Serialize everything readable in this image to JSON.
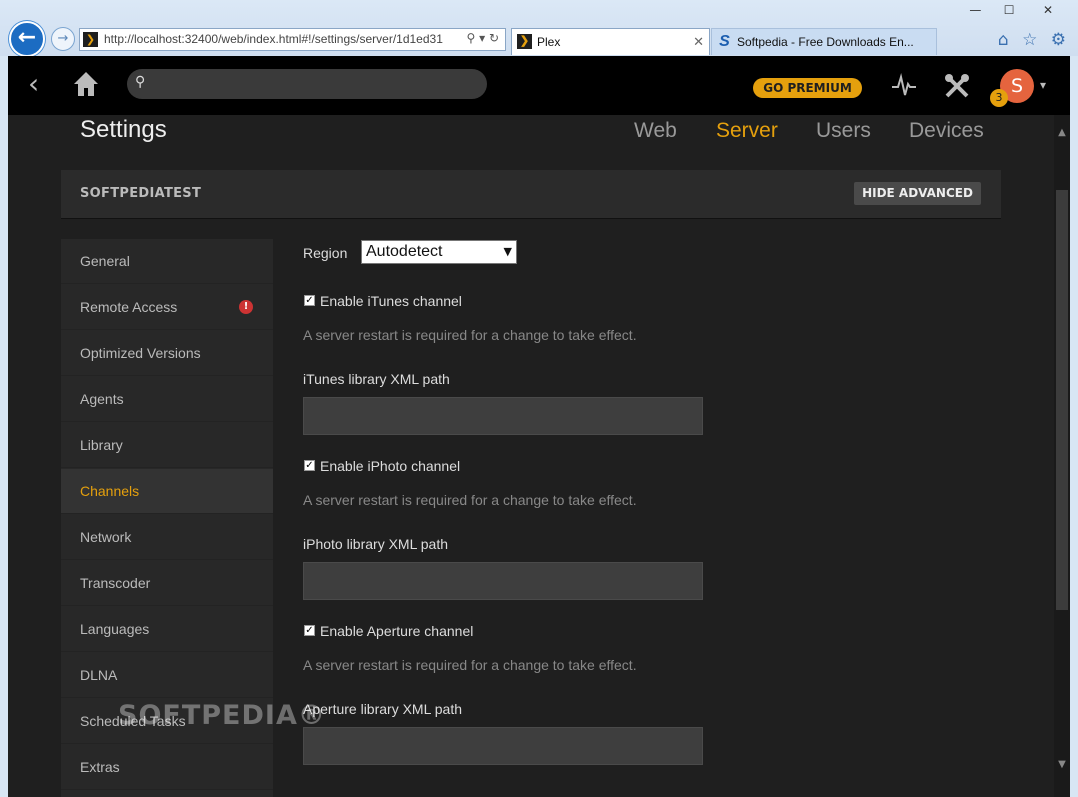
{
  "browser": {
    "address": "http://localhost:32400/web/index.html#!/settings/server/1d1ed31",
    "tabs": [
      {
        "label": "Plex",
        "favicon": "plex-chevron"
      },
      {
        "label": "Softpedia - Free Downloads En...",
        "favicon": "softpedia-s"
      }
    ],
    "window_buttons": {
      "minimize": "—",
      "maximize": "☐",
      "close": "✕"
    },
    "icons": {
      "back": "←",
      "forward": "→",
      "tab_close": "✕",
      "search": "⚲",
      "dropdown": "▾",
      "refresh": "↻",
      "home": "⌂",
      "star": "☆",
      "gear": "⚙"
    }
  },
  "topbar": {
    "back_glyph": "‹",
    "search_icon": "⚲",
    "go_premium": "GO PREMIUM",
    "avatar_letter": "S",
    "notification_count": "3",
    "caret": "▾"
  },
  "settings": {
    "title": "Settings",
    "tabs": [
      {
        "label": "Web",
        "active": false
      },
      {
        "label": "Server",
        "active": true
      },
      {
        "label": "Users",
        "active": false
      },
      {
        "label": "Devices",
        "active": false
      }
    ],
    "server_name": "SOFTPEDIATEST",
    "hide_advanced": "HIDE ADVANCED"
  },
  "sidebar": {
    "items": [
      {
        "label": "General",
        "active": false
      },
      {
        "label": "Remote Access",
        "active": false,
        "alert": "!"
      },
      {
        "label": "Optimized Versions",
        "active": false
      },
      {
        "label": "Agents",
        "active": false
      },
      {
        "label": "Library",
        "active": false
      },
      {
        "label": "Channels",
        "active": true
      },
      {
        "label": "Network",
        "active": false
      },
      {
        "label": "Transcoder",
        "active": false
      },
      {
        "label": "Languages",
        "active": false
      },
      {
        "label": "DLNA",
        "active": false
      },
      {
        "label": "Scheduled Tasks",
        "active": false
      },
      {
        "label": "Extras",
        "active": false
      }
    ]
  },
  "content": {
    "region_label": "Region",
    "region_value": "Autodetect",
    "sections": [
      {
        "checkbox_label": "Enable iTunes channel",
        "checked": true,
        "hint": "A server restart is required for a change to take effect.",
        "field_label": "iTunes library XML path",
        "value": ""
      },
      {
        "checkbox_label": "Enable iPhoto channel",
        "checked": true,
        "hint": "A server restart is required for a change to take effect.",
        "field_label": "iPhoto library XML path",
        "value": ""
      },
      {
        "checkbox_label": "Enable Aperture channel",
        "checked": true,
        "hint": "A server restart is required for a change to take effect.",
        "field_label": "Aperture library XML path",
        "value": ""
      }
    ]
  },
  "scrollbar": {
    "up": "▲",
    "down": "▼"
  },
  "watermark": "SOFTPEDIA®",
  "colors": {
    "accent": "#e5a00d",
    "avatar": "#e5643e",
    "alert": "#cc3333"
  }
}
